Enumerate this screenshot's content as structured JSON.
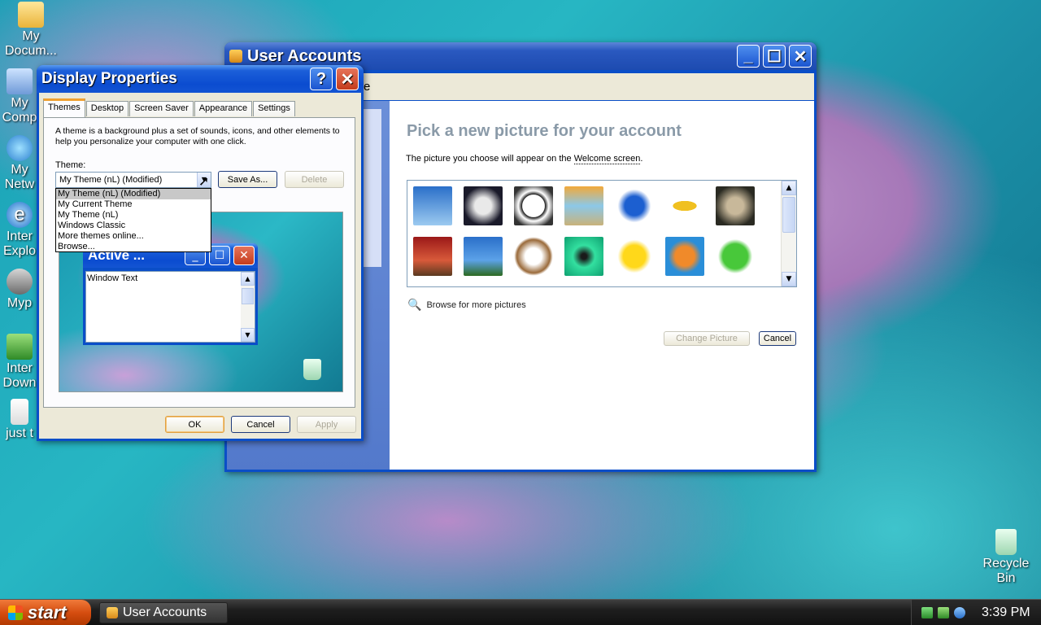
{
  "desktop": {
    "icons": [
      {
        "label": "My Docum..."
      },
      {
        "label": "My Comp"
      },
      {
        "label": "My Netw"
      },
      {
        "label": "Inter Explo"
      },
      {
        "label": "Myp"
      },
      {
        "label": "Inter Down"
      },
      {
        "label": "just t"
      },
      {
        "label": "Recycle Bin"
      }
    ]
  },
  "user_accounts": {
    "title": "User Accounts",
    "breadcrumb_fragment": "e",
    "heading": "Pick a new picture for your account",
    "description_prefix": "The picture you choose will appear on the",
    "description_link": "Welcome screen",
    "description_suffix": ".",
    "pictures": [
      "airplane",
      "astronaut",
      "soccer-ball",
      "beach-chairs",
      "butterfly",
      "race-car",
      "owl",
      "chess",
      "motorcycle",
      "dog",
      "green-ripple",
      "rubber-duck",
      "fish",
      "frog"
    ],
    "browse_link": "Browse for more pictures",
    "change_picture_label": "Change Picture",
    "cancel_label": "Cancel"
  },
  "display_properties": {
    "title": "Display Properties",
    "tabs": [
      "Themes",
      "Desktop",
      "Screen Saver",
      "Appearance",
      "Settings"
    ],
    "description": "A theme is a background plus a set of sounds, icons, and other elements to help you personalize your computer with one click.",
    "theme_label": "Theme:",
    "theme_value": "My Theme (nL) (Modified)",
    "theme_options": [
      "My Theme (nL) (Modified)",
      "My Current Theme",
      "My Theme (nL)",
      "Windows Classic",
      "More themes online...",
      "Browse..."
    ],
    "save_as_label": "Save As...",
    "delete_label": "Delete",
    "preview": {
      "window_title": "Active ...",
      "window_text": "Window Text"
    },
    "ok_label": "OK",
    "cancel_label": "Cancel",
    "apply_label": "Apply"
  },
  "taskbar": {
    "start_label": "start",
    "task_label": "User Accounts",
    "clock": "3:39 PM"
  }
}
